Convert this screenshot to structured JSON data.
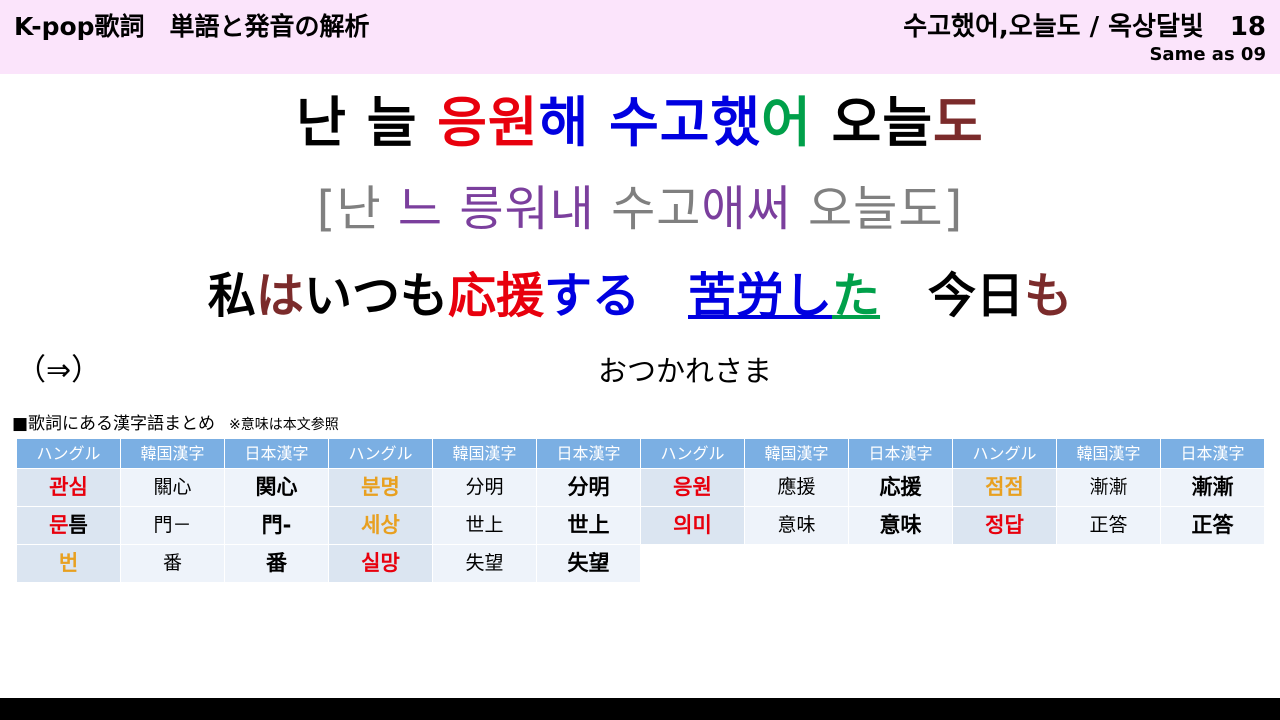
{
  "header": {
    "title": "K-pop歌詞　単語と発音の解析",
    "song": "수고했어,오늘도 / 옥상달빛　18",
    "subtitle": "Same as 09"
  },
  "colors": {
    "header_bg": "#fbe4fb",
    "black": "#000000",
    "red": "#e8000d",
    "blue": "#0000e0",
    "green": "#00a04a",
    "maroon": "#7b2b2b",
    "gray": "#808080",
    "purple": "#7b3f9d",
    "orange": "#e8a020",
    "table_header_bg": "#7bafe3",
    "hangul_cell_bg": "#dbe5f1",
    "kanji_cell_bg": "#eef3fa"
  },
  "lyric": {
    "korean": [
      {
        "text": "난 늘 ",
        "color": "black"
      },
      {
        "text": "응원",
        "color": "red"
      },
      {
        "text": "해 ",
        "color": "blue"
      },
      {
        "text": "수고했",
        "color": "blue"
      },
      {
        "text": "어",
        "color": "green"
      },
      {
        "text": " 오늘",
        "color": "black"
      },
      {
        "text": "도",
        "color": "maroon"
      }
    ],
    "pronunciation": [
      {
        "text": "[난 ",
        "color": "gray"
      },
      {
        "text": "느",
        "color": "purple"
      },
      {
        "text": " ",
        "color": "gray"
      },
      {
        "text": "릉워내",
        "color": "purple"
      },
      {
        "text": " 수고",
        "color": "gray"
      },
      {
        "text": "애써",
        "color": "purple"
      },
      {
        "text": " 오늘도]",
        "color": "gray"
      }
    ],
    "japanese": [
      {
        "text": "私",
        "color": "black",
        "underline": false
      },
      {
        "text": "は",
        "color": "maroon",
        "underline": false
      },
      {
        "text": "いつも",
        "color": "black",
        "underline": false
      },
      {
        "text": "応援",
        "color": "red",
        "underline": false
      },
      {
        "text": "する",
        "color": "blue",
        "underline": false
      },
      {
        "text": "　",
        "color": "black",
        "underline": false
      },
      {
        "text": "苦労し",
        "color": "blue",
        "underline": true
      },
      {
        "text": "た",
        "color": "green",
        "underline": true
      },
      {
        "text": "　",
        "color": "black",
        "underline": false
      },
      {
        "text": "今日",
        "color": "black",
        "underline": false
      },
      {
        "text": "も",
        "color": "maroon",
        "underline": false
      }
    ]
  },
  "note": {
    "arrow": "（⇒）",
    "text": "おつかれさま"
  },
  "table_caption": {
    "main": "■歌詞にある漢字語まとめ",
    "sub": "　※意味は本文参照"
  },
  "table": {
    "headers": [
      "ハングル",
      "韓国漢字",
      "日本漢字",
      "ハングル",
      "韓国漢字",
      "日本漢字",
      "ハングル",
      "韓国漢字",
      "日本漢字",
      "ハングル",
      "韓国漢字",
      "日本漢字"
    ],
    "rows": [
      [
        {
          "parts": [
            {
              "text": "관심",
              "color": "red"
            }
          ]
        },
        {
          "text": "關心"
        },
        {
          "text": "関心"
        },
        {
          "parts": [
            {
              "text": "분명",
              "color": "orange"
            }
          ]
        },
        {
          "text": "分明"
        },
        {
          "text": "分明"
        },
        {
          "parts": [
            {
              "text": "응원",
              "color": "red"
            }
          ]
        },
        {
          "text": "應援"
        },
        {
          "text": "応援"
        },
        {
          "parts": [
            {
              "text": "점점",
              "color": "orange"
            }
          ]
        },
        {
          "text": "漸漸"
        },
        {
          "text": "漸漸"
        }
      ],
      [
        {
          "parts": [
            {
              "text": "문",
              "color": "red"
            },
            {
              "text": "틈",
              "color": "black"
            }
          ]
        },
        {
          "text": "門－"
        },
        {
          "text": "門-"
        },
        {
          "parts": [
            {
              "text": "세상",
              "color": "orange"
            }
          ]
        },
        {
          "text": "世上"
        },
        {
          "text": "世上"
        },
        {
          "parts": [
            {
              "text": "의미",
              "color": "red"
            }
          ]
        },
        {
          "text": "意味"
        },
        {
          "text": "意味"
        },
        {
          "parts": [
            {
              "text": "정답",
              "color": "red"
            }
          ]
        },
        {
          "text": "正答"
        },
        {
          "text": "正答"
        }
      ],
      [
        {
          "parts": [
            {
              "text": "번",
              "color": "orange"
            }
          ]
        },
        {
          "text": "番"
        },
        {
          "text": "番"
        },
        {
          "parts": [
            {
              "text": "실망",
              "color": "red"
            }
          ]
        },
        {
          "text": "失望"
        },
        {
          "text": "失望"
        },
        {
          "empty": true
        },
        {
          "empty": true
        },
        {
          "empty": true
        },
        {
          "empty": true
        },
        {
          "empty": true
        },
        {
          "empty": true
        }
      ]
    ]
  }
}
